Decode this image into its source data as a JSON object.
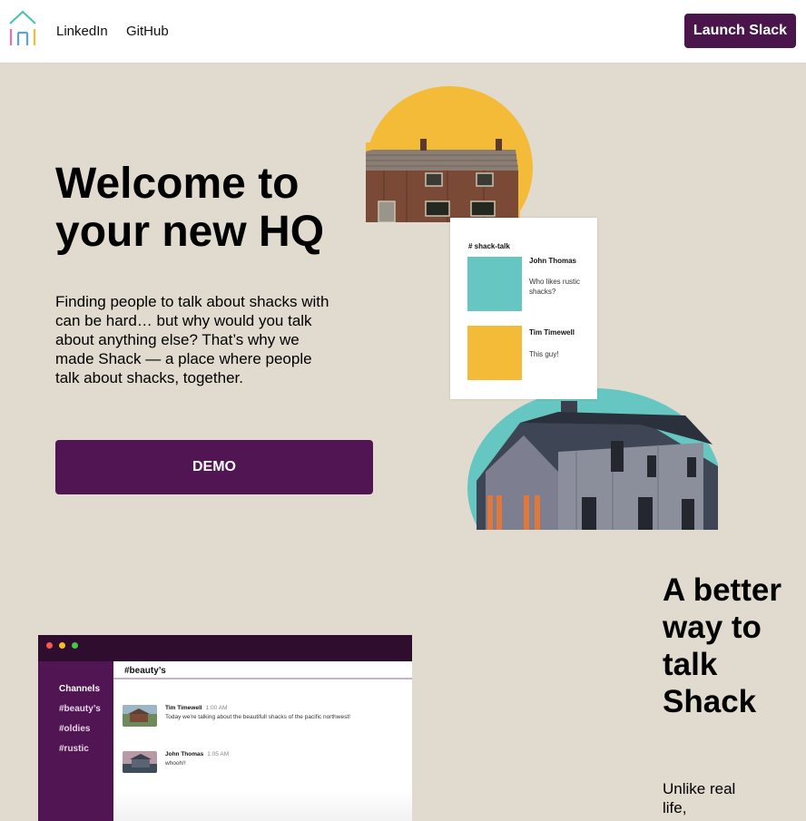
{
  "nav": {
    "logo_icon": "house-logo-icon",
    "links": [
      "LinkedIn",
      "GitHub"
    ],
    "launch_label": "Launch Slack"
  },
  "colors": {
    "brand_purple": "#4a154b",
    "page_bg": "#e1dbcf",
    "teal": "#66c6c2",
    "yellow": "#f4bb38"
  },
  "hero": {
    "title": "Welcome to your new HQ",
    "body": "Finding people to talk about shacks with can be hard… but why would you talk about anything else? That’s why we made Shack — a place where people talk about shacks, together.",
    "demo_label": "DEMO"
  },
  "chat_card": {
    "channel": "# shack-talk",
    "messages": [
      {
        "author": "John Thomas",
        "text": "Who likes rustic shacks?"
      },
      {
        "author": "Tim Timewell",
        "text": "This guy!"
      }
    ]
  },
  "app_preview": {
    "sidebar_heading": "Channels",
    "channels": [
      "#beauty’s",
      "#oldies",
      "#rustic"
    ],
    "active_channel": "#beauty’s",
    "messages": [
      {
        "author": "Tim Timewell",
        "time": "1:00 AM",
        "text": "Today we're talking about the beautifull shacks of the pacific northwest!"
      },
      {
        "author": "John Thomas",
        "time": "1:05 AM",
        "text": "whooh!!"
      }
    ]
  },
  "feature": {
    "title": "A better way to talk Shack",
    "body": "Unlike real life,"
  }
}
